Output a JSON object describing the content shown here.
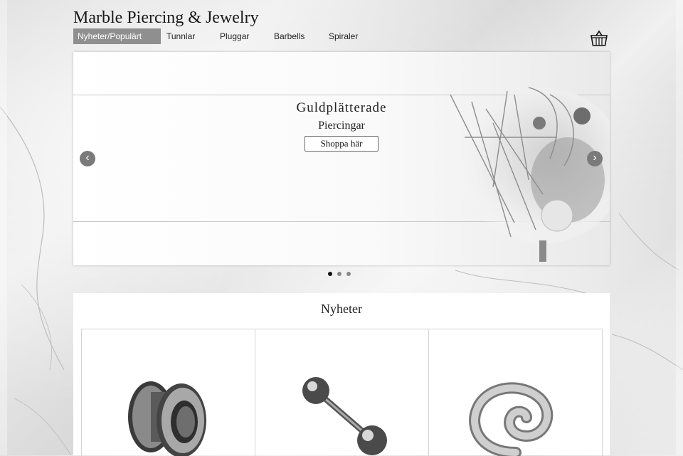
{
  "site": {
    "title": "Marble Piercing & Jewelry"
  },
  "nav": {
    "items": [
      "Nyheter/Populärt",
      "Tunnlar",
      "Pluggar",
      "Barbells",
      "Spiraler"
    ],
    "active_index": 0,
    "cart_icon": "basket-icon"
  },
  "hero": {
    "heading": "Guldplätterade",
    "subheading": "Piercingar",
    "button_label": "Shoppa här",
    "prev_icon": "chevron-left-icon",
    "next_icon": "chevron-right-icon",
    "prev_glyph": "‹",
    "next_glyph": "›",
    "slide_count": 3,
    "active_slide": 1
  },
  "news": {
    "title": "Nyheter",
    "products": [
      {
        "icon": "tunnel-plug-image"
      },
      {
        "icon": "barbell-image"
      },
      {
        "icon": "spiral-taper-image"
      }
    ]
  },
  "colors": {
    "nav_active_bg": "#8f8f8f",
    "text": "#222222"
  }
}
